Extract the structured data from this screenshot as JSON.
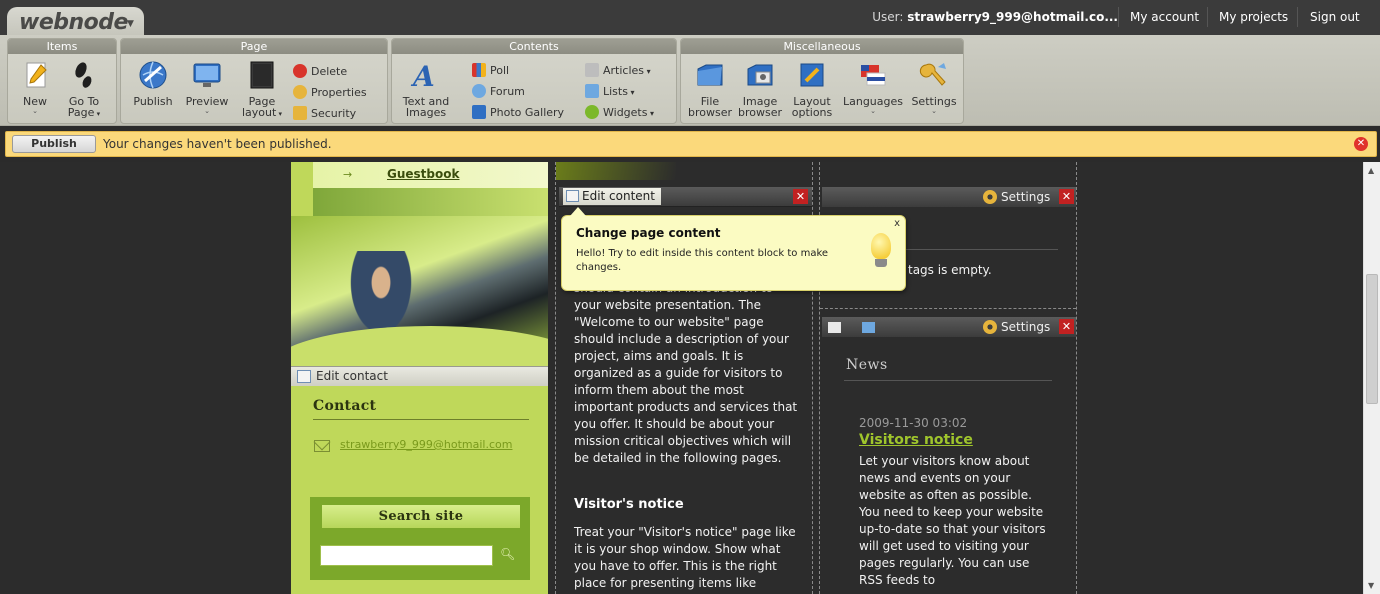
{
  "app": {
    "logo": "webnode",
    "user_label": "User:",
    "user_email": "strawberry9_999@hotmail.co...",
    "links": [
      "My account",
      "My projects",
      "Sign out"
    ]
  },
  "toolbar": {
    "groups": {
      "items": "Items",
      "page": "Page",
      "contents": "Contents",
      "misc": "Miscellaneous"
    },
    "items": {
      "new": "New",
      "goto_1": "Go To",
      "goto_2": "Page"
    },
    "page": {
      "publish": "Publish",
      "preview": "Preview",
      "layout_1": "Page",
      "layout_2": "layout",
      "delete": "Delete",
      "properties": "Properties",
      "security": "Security"
    },
    "contents": {
      "text_1": "Text and",
      "text_2": "Images",
      "poll": "Poll",
      "forum": "Forum",
      "gallery": "Photo Gallery",
      "articles": "Articles",
      "lists": "Lists",
      "widgets": "Widgets"
    },
    "misc": {
      "file_1": "File",
      "file_2": "browser",
      "image_1": "Image",
      "image_2": "browser",
      "layout_1": "Layout",
      "layout_2": "options",
      "languages": "Languages",
      "settings": "Settings"
    }
  },
  "notice": {
    "button": "Publish",
    "text": "Your changes haven't been published."
  },
  "left": {
    "nav_item": "Guestbook",
    "edit_contact": "Edit contact",
    "contact_title": "Contact",
    "email": "strawberry9_999@hotmail.com",
    "search_title": "Search site",
    "search_value": ""
  },
  "middle": {
    "edit_content": "Edit content",
    "paragraph1": "should contain an introduction to your website presentation. The \"Welcome to our website\" page should include a description of your project, aims and goals. It is organized as a guide for visitors to inform them about the most important products and services that you offer. It should be about your mission critical objectives which will be detailed in the following pages.",
    "heading2": "Visitor's notice",
    "paragraph2": "Treat your \"Visitor's notice\" page like it is your shop window. Show what you have to offer. This is the right place for presenting items like"
  },
  "tooltip": {
    "title": "Change page content",
    "text": "Hello! Try to edit inside this content block to make changes.",
    "close": "x"
  },
  "right": {
    "settings": "Settings",
    "tags_text": "tags is empty.",
    "news_title": "News",
    "news_date": "2009-11-30 03:02",
    "news_link": "Visitors notice",
    "news_text": "Let your visitors know about news and events on your website as often as possible. You need to keep your website up-to-date so that your visitors will get used to visiting your pages regularly. You can use RSS feeds to"
  },
  "colors": {
    "accent_green": "#9fc52c",
    "notice_bg": "#fbd97b",
    "toolbar_bg": "#c9c9be"
  }
}
